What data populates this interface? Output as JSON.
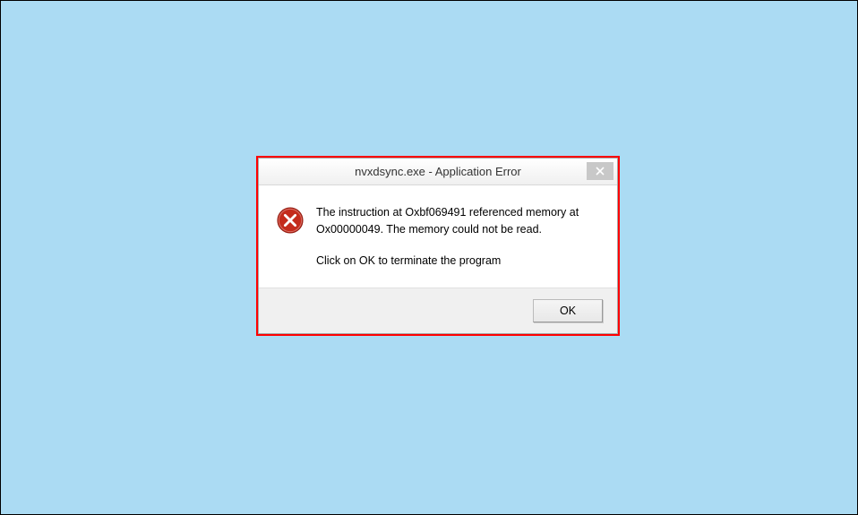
{
  "dialog": {
    "title": "nvxdsync.exe - Application Error",
    "message_line1": "The instruction at Oxbf069491 referenced memory at",
    "message_line2": "Ox00000049. The memory could not be read.",
    "message_line3": "Click on OK to terminate the program",
    "ok_label": "OK"
  }
}
